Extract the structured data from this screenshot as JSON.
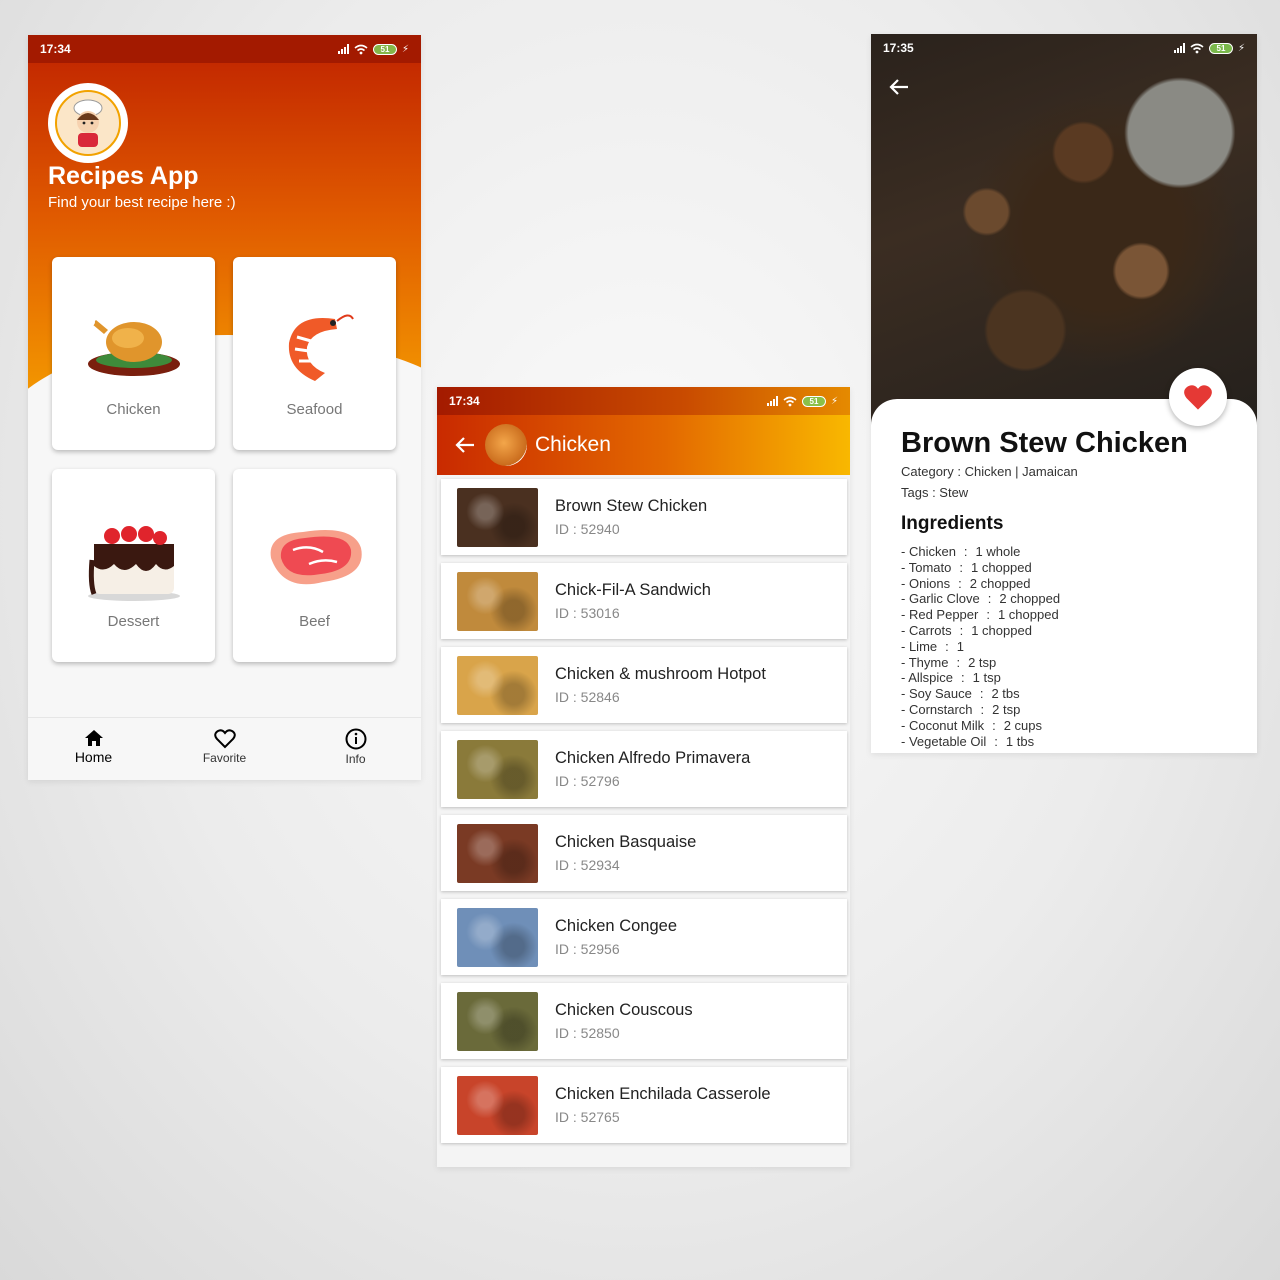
{
  "status": {
    "time_1": "17:34",
    "time_2": "17:34",
    "time_3": "17:35",
    "battery": "51"
  },
  "home": {
    "app_title": "Recipes App",
    "app_subtitle": "Find your best recipe here :)",
    "categories": [
      {
        "label": "Chicken"
      },
      {
        "label": "Seafood"
      },
      {
        "label": "Dessert"
      },
      {
        "label": "Beef"
      }
    ],
    "nav": [
      {
        "label": "Home",
        "icon": "home-icon"
      },
      {
        "label": "Favorite",
        "icon": "heart-icon"
      },
      {
        "label": "Info",
        "icon": "info-icon"
      }
    ]
  },
  "list_screen": {
    "title": "Chicken",
    "id_prefix": "ID : ",
    "items": [
      {
        "name": "Brown Stew Chicken",
        "id": "52940",
        "color": "#4a3020"
      },
      {
        "name": "Chick-Fil-A Sandwich",
        "id": "53016",
        "color": "#c08a3c"
      },
      {
        "name": "Chicken & mushroom Hotpot",
        "id": "52846",
        "color": "#d9a44a"
      },
      {
        "name": "Chicken Alfredo Primavera",
        "id": "52796",
        "color": "#8a7a3a"
      },
      {
        "name": "Chicken Basquaise",
        "id": "52934",
        "color": "#7a3a24"
      },
      {
        "name": "Chicken Congee",
        "id": "52956",
        "color": "#6f8fb8"
      },
      {
        "name": "Chicken Couscous",
        "id": "52850",
        "color": "#6a6a3a"
      },
      {
        "name": "Chicken Enchilada Casserole",
        "id": "52765",
        "color": "#c8442a"
      }
    ]
  },
  "detail": {
    "title": "Brown Stew Chicken",
    "category": "Category : Chicken | Jamaican",
    "tags": "Tags : Stew",
    "ingredients_heading": "Ingredients",
    "ingredients": [
      {
        "name": "Chicken",
        "measure": "1 whole"
      },
      {
        "name": "Tomato",
        "measure": "1 chopped"
      },
      {
        "name": "Onions",
        "measure": "2 chopped"
      },
      {
        "name": "Garlic Clove",
        "measure": "2 chopped"
      },
      {
        "name": "Red Pepper",
        "measure": "1 chopped"
      },
      {
        "name": "Carrots",
        "measure": "1 chopped"
      },
      {
        "name": "Lime",
        "measure": "1"
      },
      {
        "name": "Thyme",
        "measure": "2 tsp"
      },
      {
        "name": "Allspice",
        "measure": "1 tsp"
      },
      {
        "name": "Soy Sauce",
        "measure": "2 tbs"
      },
      {
        "name": "Cornstarch",
        "measure": "2 tsp"
      },
      {
        "name": "Coconut Milk",
        "measure": "2 cups"
      },
      {
        "name": "Vegetable Oil",
        "measure": "1 tbs"
      }
    ]
  },
  "colors": {
    "accent_red": "#c42a00",
    "accent_orange": "#f49a00",
    "heart": "#e53935"
  }
}
